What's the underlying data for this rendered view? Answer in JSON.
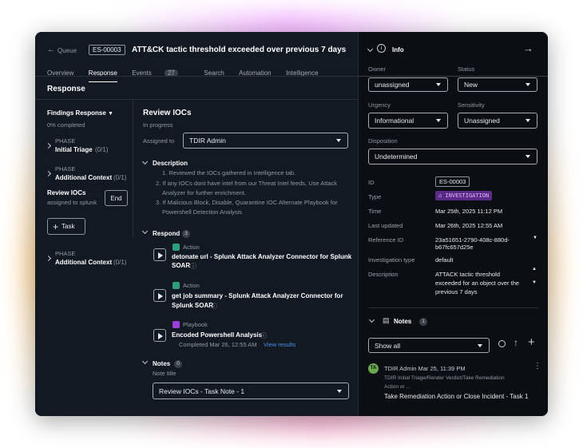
{
  "header": {
    "back_label": "Queue",
    "case_id": "ES-00003",
    "title": "ATT&CK tactic threshold exceeded over previous 7 days"
  },
  "tabs": [
    {
      "label": "Overview"
    },
    {
      "label": "Response",
      "active": true
    },
    {
      "label": "Events",
      "count": "27"
    },
    {
      "label": "Search"
    },
    {
      "label": "Automation"
    },
    {
      "label": "Intelligence"
    }
  ],
  "response": {
    "heading": "Response",
    "findings_title": "Findings Response",
    "completed": "0% completed",
    "phases": [
      {
        "tag": "PHASE",
        "name": "Initial Triage",
        "count": "(0/1)"
      },
      {
        "tag": "PHASE",
        "name": "Additional Context",
        "count": "(0/1)"
      }
    ],
    "review_task": {
      "name": "Review IOCs",
      "assignee": "assigned to splunk",
      "end_label": "End"
    },
    "task_button": "Task",
    "phase3": {
      "tag": "PHASE",
      "name": "Additional Context",
      "count": "(0/1)"
    }
  },
  "detail": {
    "title": "Review IOCs",
    "status": "In progress",
    "assigned_label": "Assigned to",
    "assigned_value": "TDIR Admin",
    "description_label": "Description",
    "description_items": [
      "1. Reviewed the IOCs gathered in Intelligence tab.",
      "2. If any IOCs dont have intel from our Threat Intel feeds, Use Attack",
      "Analyzer for further enrichment.",
      "3. If Malicious Block, Disable, Quarantine IOC Alternate Playbook for",
      "Powershell Detection Analysis"
    ],
    "respond_label": "Respond",
    "respond_count": "3",
    "actions": [
      {
        "type": "Action",
        "line1": "detonate url - Splunk Attack Analyzer Connector for Splunk",
        "line2": "SOAR"
      },
      {
        "type": "Action",
        "line1": "get job summary - Splunk Attack Analyzer Connector for",
        "line2": "Splunk SOAR"
      },
      {
        "type": "Playbook",
        "line1": "Encoded Powershell Analysis",
        "completed": "Completed Mar 26, 12:55 AM",
        "view_link": "View results"
      }
    ],
    "notes_label": "Notes",
    "notes_count": "0",
    "note_title_label": "Note title",
    "note_title_value": "Review IOCs - Task Note - 1"
  },
  "info": {
    "title": "Info",
    "owner_label": "Owner",
    "owner_value": "unassigned",
    "status_label": "Status",
    "status_value": "New",
    "urgency_label": "Urgency",
    "urgency_value": "Informational",
    "sensitivity_label": "Sensitivity",
    "sensitivity_value": "Unassigned",
    "disposition_label": "Disposition",
    "disposition_value": "Undetermined",
    "fields": {
      "id_label": "ID",
      "id_value": "ES-00003",
      "type_label": "Type",
      "type_value": "INVESTIGATION",
      "time_label": "Time",
      "time_value": "Mar 25th, 2025 11:12 PM",
      "updated_label": "Last updated",
      "updated_value": "Mar 26th, 2025 12:55 AM",
      "ref_label": "Reference ID",
      "ref_line1": "23a51651-2790-408c-880d-",
      "ref_line2": "b67fc657d25e",
      "invtype_label": "Investigation type",
      "invtype_value": "default",
      "desc_label": "Description",
      "desc_line1": "ATTACK tactic threshold",
      "desc_line2": "exceeded for an object over the",
      "desc_line3": "previous 7 days"
    },
    "notes_label": "Notes",
    "notes_count": "1",
    "filter_value": "Show all",
    "note": {
      "avatar": "TA",
      "author_time": "TDIR Admin Mar 25, 11:39 PM",
      "path": "TDIR Initial Triage/Render Verdict/Take Remediation",
      "path2": "Action or ...",
      "text": "Take Remediation Action or Close Incident - Task 1"
    }
  },
  "colors": {
    "accent_link": "#4a90e2",
    "playbook": "#9b3fd9",
    "action": "#2f9e7a",
    "type_badge": "#5b2a86"
  }
}
